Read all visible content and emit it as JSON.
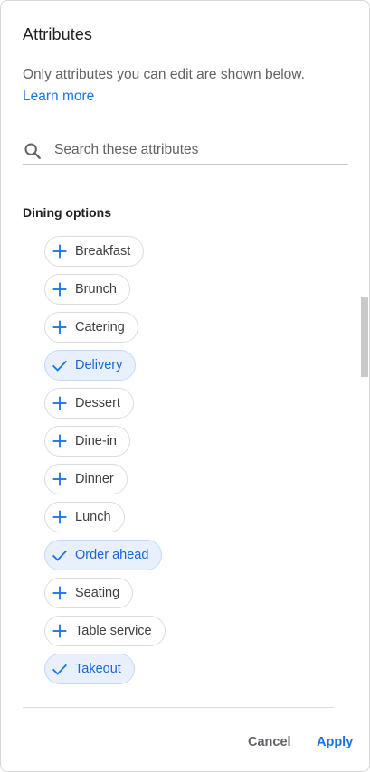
{
  "dialog": {
    "title": "Attributes",
    "subtitle": "Only attributes you can edit are shown below.",
    "learn_more": "Learn more"
  },
  "search": {
    "placeholder": "Search these attributes",
    "value": "",
    "icon": "search-icon"
  },
  "section": {
    "label": "Dining options",
    "chips": [
      {
        "label": "Breakfast",
        "selected": false
      },
      {
        "label": "Brunch",
        "selected": false
      },
      {
        "label": "Catering",
        "selected": false
      },
      {
        "label": "Delivery",
        "selected": true
      },
      {
        "label": "Dessert",
        "selected": false
      },
      {
        "label": "Dine-in",
        "selected": false
      },
      {
        "label": "Dinner",
        "selected": false
      },
      {
        "label": "Lunch",
        "selected": false
      },
      {
        "label": "Order ahead",
        "selected": true
      },
      {
        "label": "Seating",
        "selected": false
      },
      {
        "label": "Table service",
        "selected": false
      },
      {
        "label": "Takeout",
        "selected": true
      }
    ]
  },
  "actions": {
    "cancel_label": "Cancel",
    "apply_label": "Apply"
  },
  "colors": {
    "accent": "#1a73e8",
    "selected_bg": "#e8f0fe",
    "selected_text": "#1967d2",
    "chip_border": "#dadce0"
  }
}
